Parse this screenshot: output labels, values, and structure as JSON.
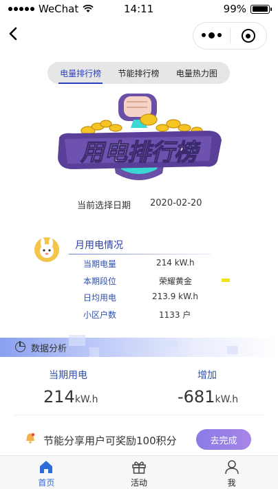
{
  "status_bar": {
    "carrier": "WeChat",
    "time": "14:11",
    "battery": "99%",
    "battery_level": 0.99
  },
  "nav": {
    "back_icon": "chevron-left-icon",
    "more_icon": "more-dots-icon",
    "close_icon": "target-icon"
  },
  "tabs": [
    {
      "label": "电量排行榜",
      "active": true
    },
    {
      "label": "节能排行榜",
      "active": false
    },
    {
      "label": "电量热力图",
      "active": false
    }
  ],
  "banner": {
    "title": "用电排行榜",
    "colors": {
      "primary": "#6a4fa6",
      "accent": "#3ad7d3",
      "coin": "#f5c425"
    }
  },
  "date": {
    "label": "当前选择日期",
    "value": "2020-02-20"
  },
  "monthly": {
    "title": "月用电情况",
    "rows": [
      {
        "key": "当期电量",
        "value": "214 kW.h"
      },
      {
        "key": "本期段位",
        "value": "荣耀黄金"
      },
      {
        "key": "日均用电",
        "value": "213.9 kW.h"
      },
      {
        "key": "小区户数",
        "value": "1133 户"
      }
    ]
  },
  "analysis": {
    "title": "数据分析",
    "current_label": "当期用电",
    "current_value": "214",
    "current_unit": "kW.h",
    "increase_label": "增加",
    "increase_value": "-681",
    "increase_unit": "kW.h"
  },
  "share": {
    "text": "节能分享用户可奖励100积分",
    "button": "去完成"
  },
  "tabbar": [
    {
      "label": "首页",
      "icon": "home-icon",
      "active": true
    },
    {
      "label": "活动",
      "icon": "gift-icon",
      "active": false
    },
    {
      "label": "我",
      "icon": "user-icon",
      "active": false
    }
  ],
  "colors": {
    "accent": "#2b3fc2",
    "tab_active": "#2b6cd8",
    "button": "#9a80e8"
  }
}
